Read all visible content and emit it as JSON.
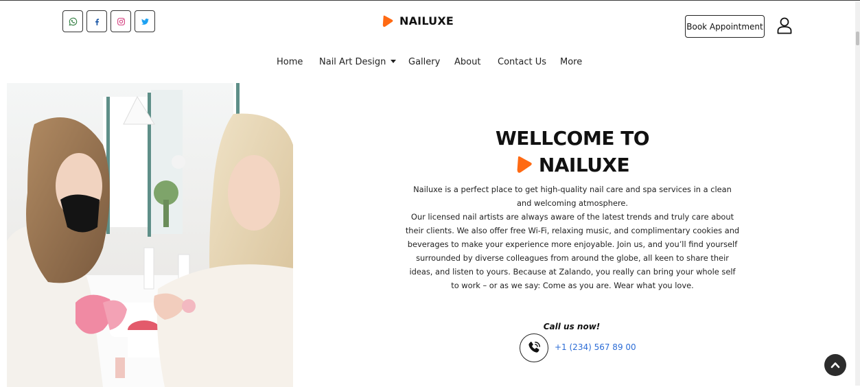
{
  "header": {
    "brand": "NAILUXE",
    "book_label": "Book Appointment",
    "socials": [
      "whatsapp-icon",
      "facebook-icon",
      "instagram-icon",
      "twitter-icon"
    ]
  },
  "nav": {
    "items": [
      {
        "label": "Home"
      },
      {
        "label": "Nail Art Design"
      },
      {
        "label": "Gallery"
      },
      {
        "label": "About"
      },
      {
        "label": "Contact Us"
      },
      {
        "label": "More"
      }
    ]
  },
  "hero": {
    "title_line1": "WELLCOME TO",
    "title_brand": "NAILUXE",
    "paragraph1": "Nailuxe is a perfect place to get high-quality nail care and spa services in a clean and welcoming atmosphere.",
    "paragraph2": "Our licensed nail artists are always aware of the latest trends and truly care about their clients. We also offer free Wi-Fi, relaxing music, and complimentary cookies and beverages to make your experience more enjoyable. Join us, and you’ll find yourself surrounded by diverse colleagues from around the globe, all keen to share their ideas, and listen to yours. Because at Zalando, you really can bring your whole self to work – or as we say: Come as you are. Wear what you love.",
    "call_label": "Call us now!",
    "phone": "+1 (234) 567 89 00"
  },
  "colors": {
    "brand_orange": "#ff6a13",
    "link_blue": "#2b6cd6"
  }
}
